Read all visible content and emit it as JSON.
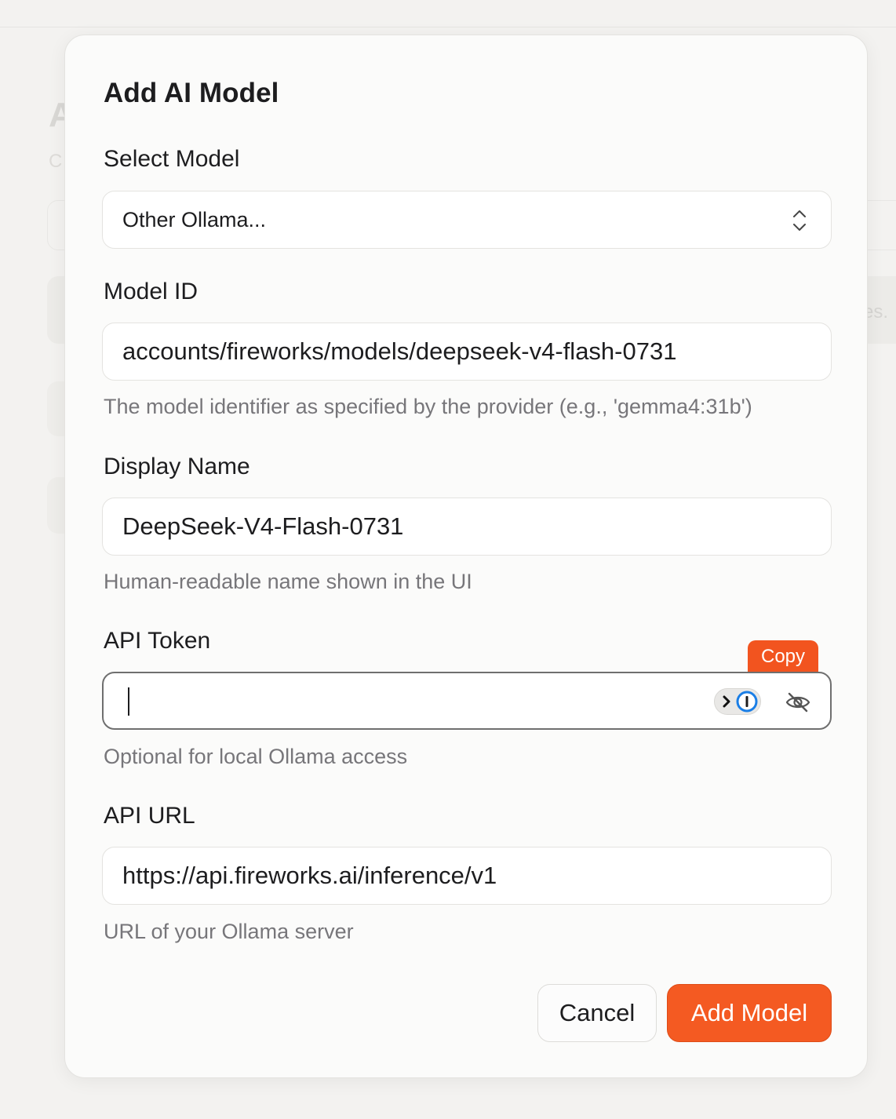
{
  "background": {
    "heading_partial": "A",
    "subtitle_partial": "C",
    "side_text_partial": "es."
  },
  "dialog": {
    "title": "Add AI Model",
    "select_model": {
      "label": "Select Model",
      "value": "Other Ollama..."
    },
    "model_id": {
      "label": "Model ID",
      "value": "accounts/fireworks/models/deepseek-v4-flash-0731",
      "hint": "The model identifier as specified by the provider (e.g., 'gemma4:31b')"
    },
    "display_name": {
      "label": "Display Name",
      "value": "DeepSeek-V4-Flash-0731",
      "hint": "Human-readable name shown in the UI"
    },
    "api_token": {
      "label": "API Token",
      "value": "",
      "hint": "Optional for local Ollama access",
      "copy_label": "Copy",
      "password_manager_icon": "1password-icon",
      "visibility_icon": "eye-slash-icon"
    },
    "api_url": {
      "label": "API URL",
      "value": "https://api.fireworks.ai/inference/v1",
      "hint": "URL of your Ollama server"
    },
    "buttons": {
      "cancel": "Cancel",
      "submit": "Add Model"
    }
  },
  "colors": {
    "accent": "#f45a22",
    "password_manager_blue": "#1a7ee6"
  }
}
